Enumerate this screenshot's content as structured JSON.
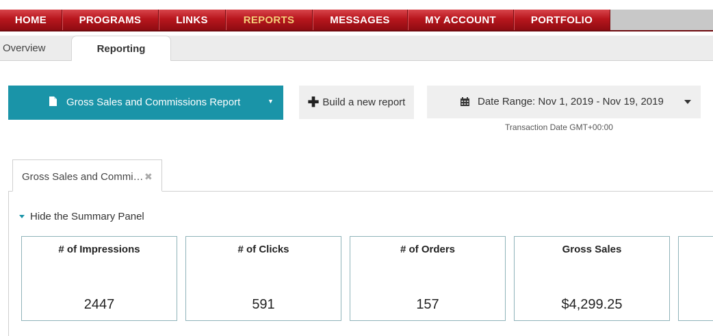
{
  "nav": {
    "items": [
      {
        "label": "HOME",
        "active": false
      },
      {
        "label": "PROGRAMS",
        "active": false
      },
      {
        "label": "LINKS",
        "active": false
      },
      {
        "label": "REPORTS",
        "active": true
      },
      {
        "label": "MESSAGES",
        "active": false
      },
      {
        "label": "MY ACCOUNT",
        "active": false
      },
      {
        "label": "PORTFOLIO",
        "active": false
      }
    ],
    "active_color": "#f3cf7a",
    "bar_color": "#b8161d"
  },
  "subtabs": {
    "overview": "Overview",
    "reporting": "Reporting"
  },
  "toolbar": {
    "report_select": {
      "label": "Gross Sales and Commissions Report",
      "icon": "document-icon",
      "color": "#1a94a8"
    },
    "build_button": {
      "label": "Build a new report",
      "icon": "plus-icon"
    },
    "date_range": {
      "label": "Date Range: Nov 1, 2019 - Nov 19, 2019",
      "icon": "calendar-icon"
    },
    "timezone_note": "Transaction Date GMT+00:00"
  },
  "report_tab": {
    "label": "Gross Sales and Commi…",
    "close_icon": "close-icon"
  },
  "summary": {
    "toggle_label": "Hide the Summary Panel",
    "cards": [
      {
        "title": "# of Impressions",
        "value": "2447"
      },
      {
        "title": "# of Clicks",
        "value": "591"
      },
      {
        "title": "# of Orders",
        "value": "157"
      },
      {
        "title": "Gross Sales",
        "value": "$4,299.25"
      }
    ]
  }
}
